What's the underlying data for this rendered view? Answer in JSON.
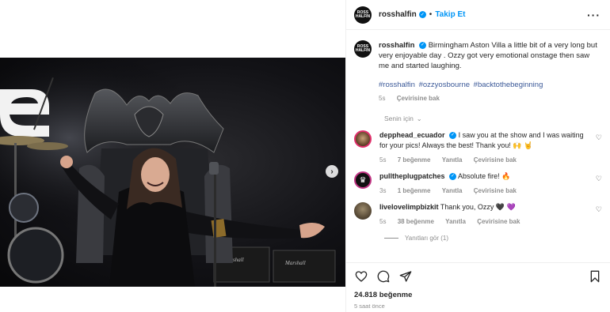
{
  "post": {
    "username": "rosshalfin",
    "avatar_text": "ROSS HALFIN",
    "follow_label": "Takip Et",
    "more_icon": "more-icon",
    "next_icon": "chevron-right-icon"
  },
  "caption": {
    "username": "rosshalfin",
    "text": "Birmingham Aston Villa a little bit of a very long but very enjoyable day . Ozzy got very emotional onstage then saw me and started laughing.",
    "hashtags": [
      "#rosshalfin",
      "#ozzyosbourne",
      "#backtothebeginning"
    ],
    "time": "5s",
    "translate": "Çevirisine bak"
  },
  "for_you": {
    "label": "Senin için"
  },
  "comments": [
    {
      "username": "depphead_ecuador",
      "verified": true,
      "text": "I saw you at the show and I was waiting for your pics! Always the best! Thank you! 🙌 🤘",
      "time": "5s",
      "likes": "7 beğenme",
      "reply": "Yanıtla",
      "translate": "Çevirisine bak"
    },
    {
      "username": "pulltheplugpatches",
      "verified": true,
      "text": "Absolute fire! 🔥",
      "time": "3s",
      "likes": "1 beğenme",
      "reply": "Yanıtla",
      "translate": "Çevirisine bak"
    },
    {
      "username": "livelovelimpbizkit",
      "verified": false,
      "text": "Thank you, Ozzy 🖤 💜",
      "time": "5s",
      "likes": "38 beğenme",
      "reply": "Yanıtla",
      "translate": "Çevirisine bak"
    }
  ],
  "replies": {
    "label": "Yanıtları gör (1)"
  },
  "footer": {
    "likes": "24.818 beğenme",
    "time": "5 saat önce"
  },
  "colors": {
    "accent": "#0095f6",
    "text": "#262626",
    "muted": "#8e8e8e"
  }
}
